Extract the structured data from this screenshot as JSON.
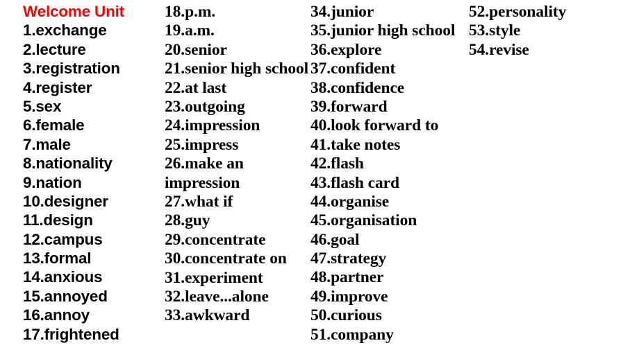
{
  "page": {
    "background_color": "#ffffff",
    "title_color": "#ff0000",
    "body_color": "#000000"
  },
  "columns": [
    {
      "id": "column-1",
      "heading": "Welcome Unit",
      "entries": [
        "1.exchange",
        "2.lecture",
        "3.registration",
        "4.register",
        "5.sex",
        "6.female",
        "7.male",
        "8.nationality",
        "9.nation",
        "10.designer",
        "11.design",
        "12.campus",
        "13.formal",
        "14.anxious",
        "15.annoyed",
        "16.annoy",
        "17.frightened"
      ]
    },
    {
      "id": "column-2",
      "entries": [
        "18.p.m.",
        "19.a.m.",
        "20.senior",
        "21.senior high school",
        "22.at last",
        "23.outgoing",
        "24.impression",
        "25.impress",
        "26.make an impression",
        "27.what if",
        "28.guy",
        "29.concentrate",
        "30.concentrate on",
        "31.experiment",
        "32.leave...alone",
        "33.awkward"
      ]
    },
    {
      "id": "column-3",
      "entries": [
        "34.junior",
        "35.junior high school",
        "36.explore",
        "37.confident",
        "38.confidence",
        "39.forward",
        "40.look forward to",
        "41.take notes",
        "42.flash",
        "43.flash card",
        "44.organise",
        "45.organisation",
        "46.goal",
        "47.strategy",
        "48.partner",
        "49.improve",
        "50.curious",
        "51.company"
      ]
    },
    {
      "id": "column-4",
      "entries": [
        "52.personality",
        "53.style",
        "54.revise"
      ]
    }
  ]
}
